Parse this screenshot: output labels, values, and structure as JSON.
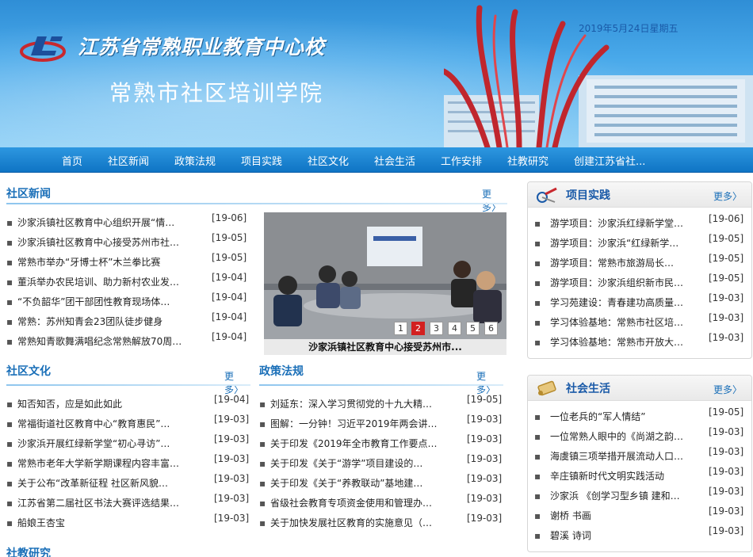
{
  "header": {
    "school_name": "江苏省常熟职业教育中心校",
    "college_name": "常熟市社区培训学院",
    "date": "2019年5月24日星期五"
  },
  "nav": [
    "首页",
    "社区新闻",
    "政策法规",
    "项目实践",
    "社区文化",
    "社会生活",
    "工作安排",
    "社教研究",
    "创建江苏省社..."
  ],
  "more_label": "更多",
  "community_news": {
    "title": "社区新闻",
    "items": [
      {
        "text": "沙家浜镇社区教育中心组织开展“情…",
        "date": "[19-06]"
      },
      {
        "text": "沙家浜镇社区教育中心接受苏州市社…",
        "date": "[19-05]"
      },
      {
        "text": "常熟市举办“牙博士杯”木兰拳比赛",
        "date": "[19-05]"
      },
      {
        "text": "董浜举办农民培训、助力新村农业发…",
        "date": "[19-04]"
      },
      {
        "text": "“不负韶华”团干部团性教育现场体…",
        "date": "[19-04]"
      },
      {
        "text": "常熟：苏州知青会23团队徒步健身",
        "date": "[19-04]"
      },
      {
        "text": "常熟知青歌舞满唱纪念常熟解放70周…",
        "date": "[19-04]"
      }
    ],
    "photo_caption": "沙家浜镇社区教育中心接受苏州市...",
    "slides": [
      "1",
      "2",
      "3",
      "4",
      "5",
      "6"
    ],
    "active_slide": "2"
  },
  "community_culture": {
    "title": "社区文化",
    "items": [
      {
        "text": "知否知否，应是如此如此",
        "date": "[19-04]"
      },
      {
        "text": "常福街道社区教育中心“教育惠民”…",
        "date": "[19-03]"
      },
      {
        "text": "沙家浜开展红绿新学堂“初心寻访”…",
        "date": "[19-03]"
      },
      {
        "text": "常熟市老年大学新学期课程内容丰富…",
        "date": "[19-03]"
      },
      {
        "text": "关于公布“改革新征程 社区新风貌…",
        "date": "[19-03]"
      },
      {
        "text": "江苏省第二届社区书法大赛评选结果…",
        "date": "[19-03]"
      },
      {
        "text": "船娘王杏宝",
        "date": "[19-03]"
      }
    ]
  },
  "policy": {
    "title": "政策法规",
    "items": [
      {
        "text": "刘延东：深入学习贯彻党的十九大精…",
        "date": "[19-05]"
      },
      {
        "text": "图解：一分钟！习近平2019年两会讲…",
        "date": "[19-03]"
      },
      {
        "text": "关于印发《2019年全市教育工作要点…",
        "date": "[19-03]"
      },
      {
        "text": "关于印发《关于“游学”项目建设的…",
        "date": "[19-03]"
      },
      {
        "text": "关于印发《关于“养教联动”基地建…",
        "date": "[19-03]"
      },
      {
        "text": "省级社会教育专项资金使用和管理办…",
        "date": "[19-03]"
      },
      {
        "text": "关于加快发展社区教育的实施意见（…",
        "date": "[19-03]"
      }
    ]
  },
  "next_section_title": "社教研究",
  "projects": {
    "title": "项目实践",
    "items": [
      {
        "text": "游学项目：沙家浜红绿新学堂…",
        "date": "[19-06]"
      },
      {
        "text": "游学项目：沙家浜“红绿新学…",
        "date": "[19-05]"
      },
      {
        "text": "游学项目：常熟市旅游局长…",
        "date": "[19-05]"
      },
      {
        "text": "游学项目：沙家浜组织新市民…",
        "date": "[19-05]"
      },
      {
        "text": "学习苑建设：青春建功高质量…",
        "date": "[19-03]"
      },
      {
        "text": "学习体验基地：常熟市社区培…",
        "date": "[19-03]"
      },
      {
        "text": "学习体验基地：常熟市开放大…",
        "date": "[19-03]"
      }
    ]
  },
  "social_life": {
    "title": "社会生活",
    "items": [
      {
        "text": "一位老兵的“军人情结”",
        "date": "[19-05]"
      },
      {
        "text": "一位常熟人眼中的《尚湖之韵…",
        "date": "[19-03]"
      },
      {
        "text": "海虞镇三项举措开展流动人口…",
        "date": "[19-03]"
      },
      {
        "text": "辛庄镇新时代文明实践活动",
        "date": "[19-03]"
      },
      {
        "text": "沙家浜 《创学习型乡镇 建和…",
        "date": "[19-03]"
      },
      {
        "text": "谢桥 书画",
        "date": "[19-03]"
      },
      {
        "text": "碧溪 诗词",
        "date": "[19-03]"
      }
    ]
  }
}
